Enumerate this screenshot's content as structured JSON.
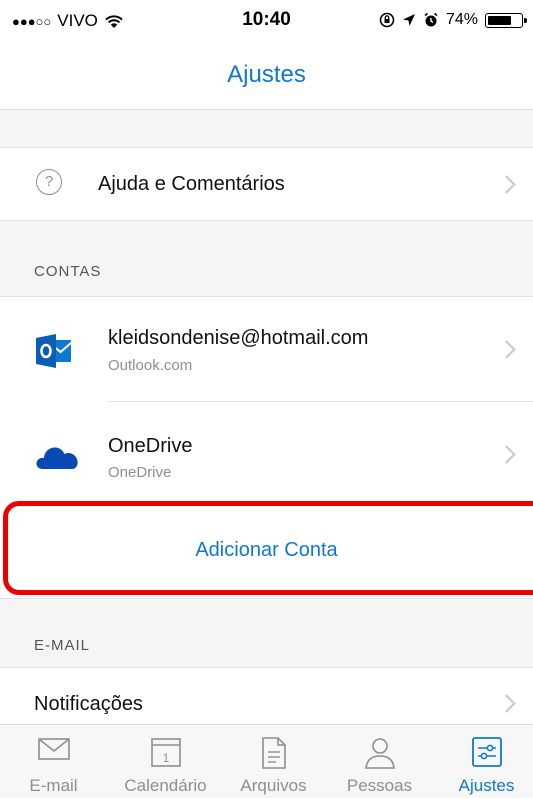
{
  "status_bar": {
    "signal": "●●●○○",
    "carrier": "VIVO",
    "wifi_icon": "wifi-icon",
    "time": "10:40",
    "battery_percent": "74%",
    "battery_level": 0.74
  },
  "header": {
    "title": "Ajustes"
  },
  "help_row": {
    "label": "Ajuda e Comentários",
    "icon": "help-circle-icon"
  },
  "accounts_section": {
    "title": "CONTAS",
    "items": [
      {
        "title": "kleidsondenise@hotmail.com",
        "subtitle": "Outlook.com",
        "icon": "outlook-icon"
      },
      {
        "title": "OneDrive",
        "subtitle": "OneDrive",
        "icon": "onedrive-icon"
      }
    ],
    "add_account": "Adicionar Conta"
  },
  "email_section": {
    "title": "E-MAIL",
    "items": [
      {
        "label": "Notificações"
      }
    ]
  },
  "tab_bar": {
    "tabs": [
      {
        "label": "E-mail",
        "icon": "mail-icon"
      },
      {
        "label": "Calendário",
        "icon": "calendar-icon",
        "badge": "1"
      },
      {
        "label": "Arquivos",
        "icon": "file-icon"
      },
      {
        "label": "Pessoas",
        "icon": "person-icon"
      },
      {
        "label": "Ajustes",
        "icon": "settings-sliders-icon",
        "active": true
      }
    ]
  },
  "colors": {
    "accent": "#0f78d4",
    "highlight": "#ee0000",
    "outlook": "#0f78d4",
    "onedrive": "#094ab2"
  }
}
